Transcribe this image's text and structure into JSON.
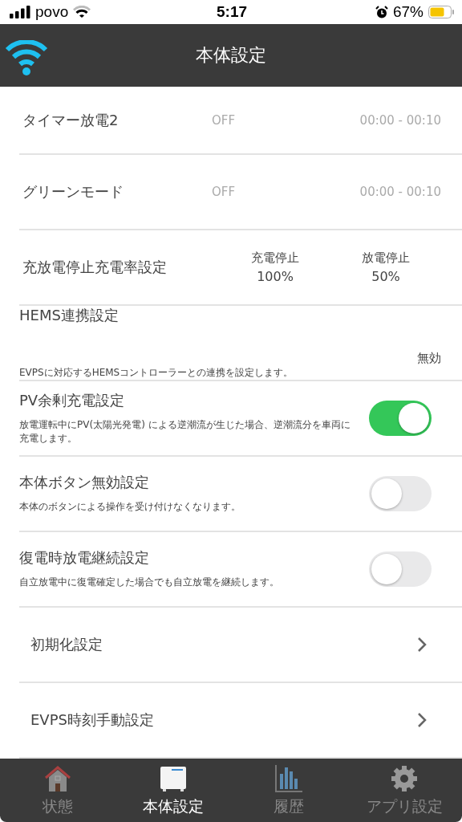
{
  "status_bar": {
    "carrier": "povo",
    "time": "5:17",
    "battery": "67%"
  },
  "header": {
    "title": "本体設定"
  },
  "rows": [
    {
      "kind": "timer",
      "label": "タイマー放電2",
      "status": "OFF",
      "time": "00:00 - 00:10"
    },
    {
      "kind": "timer",
      "label": "グリーンモード",
      "status": "OFF",
      "time": "00:00 - 00:10"
    },
    {
      "kind": "rate",
      "label": "充放電停止充電率設定",
      "items": [
        {
          "label": "充電停止",
          "value": "100%"
        },
        {
          "label": "放電停止",
          "value": "50%"
        }
      ]
    },
    {
      "kind": "value",
      "title": "HEMS連携設定",
      "value": "無効",
      "description": "EVPSに対応するHEMSコントローラーとの連携を設定します。"
    },
    {
      "kind": "toggle",
      "title": "PV余剰充電設定",
      "on": true,
      "description": "放電運転中にPV(太陽光発電) による逆潮流が生じた場合、逆潮流分を車両に充電します。"
    },
    {
      "kind": "toggle",
      "title": "本体ボタン無効設定",
      "on": false,
      "description": "本体のボタンによる操作を受け付けなくなります。"
    },
    {
      "kind": "toggle",
      "title": "復電時放電継続設定",
      "on": false,
      "description": "自立放電中に復電確定した場合でも自立放電を継続します。"
    },
    {
      "kind": "link",
      "label": "初期化設定"
    },
    {
      "kind": "link",
      "label": "EVPS時刻手動設定"
    }
  ],
  "tabs": [
    {
      "kind": "house",
      "label": "状態",
      "selected": false
    },
    {
      "kind": "unit",
      "label": "本体設定",
      "selected": true
    },
    {
      "kind": "chart",
      "label": "履歴",
      "selected": false
    },
    {
      "kind": "gear",
      "label": "アプリ設定",
      "selected": false
    }
  ]
}
